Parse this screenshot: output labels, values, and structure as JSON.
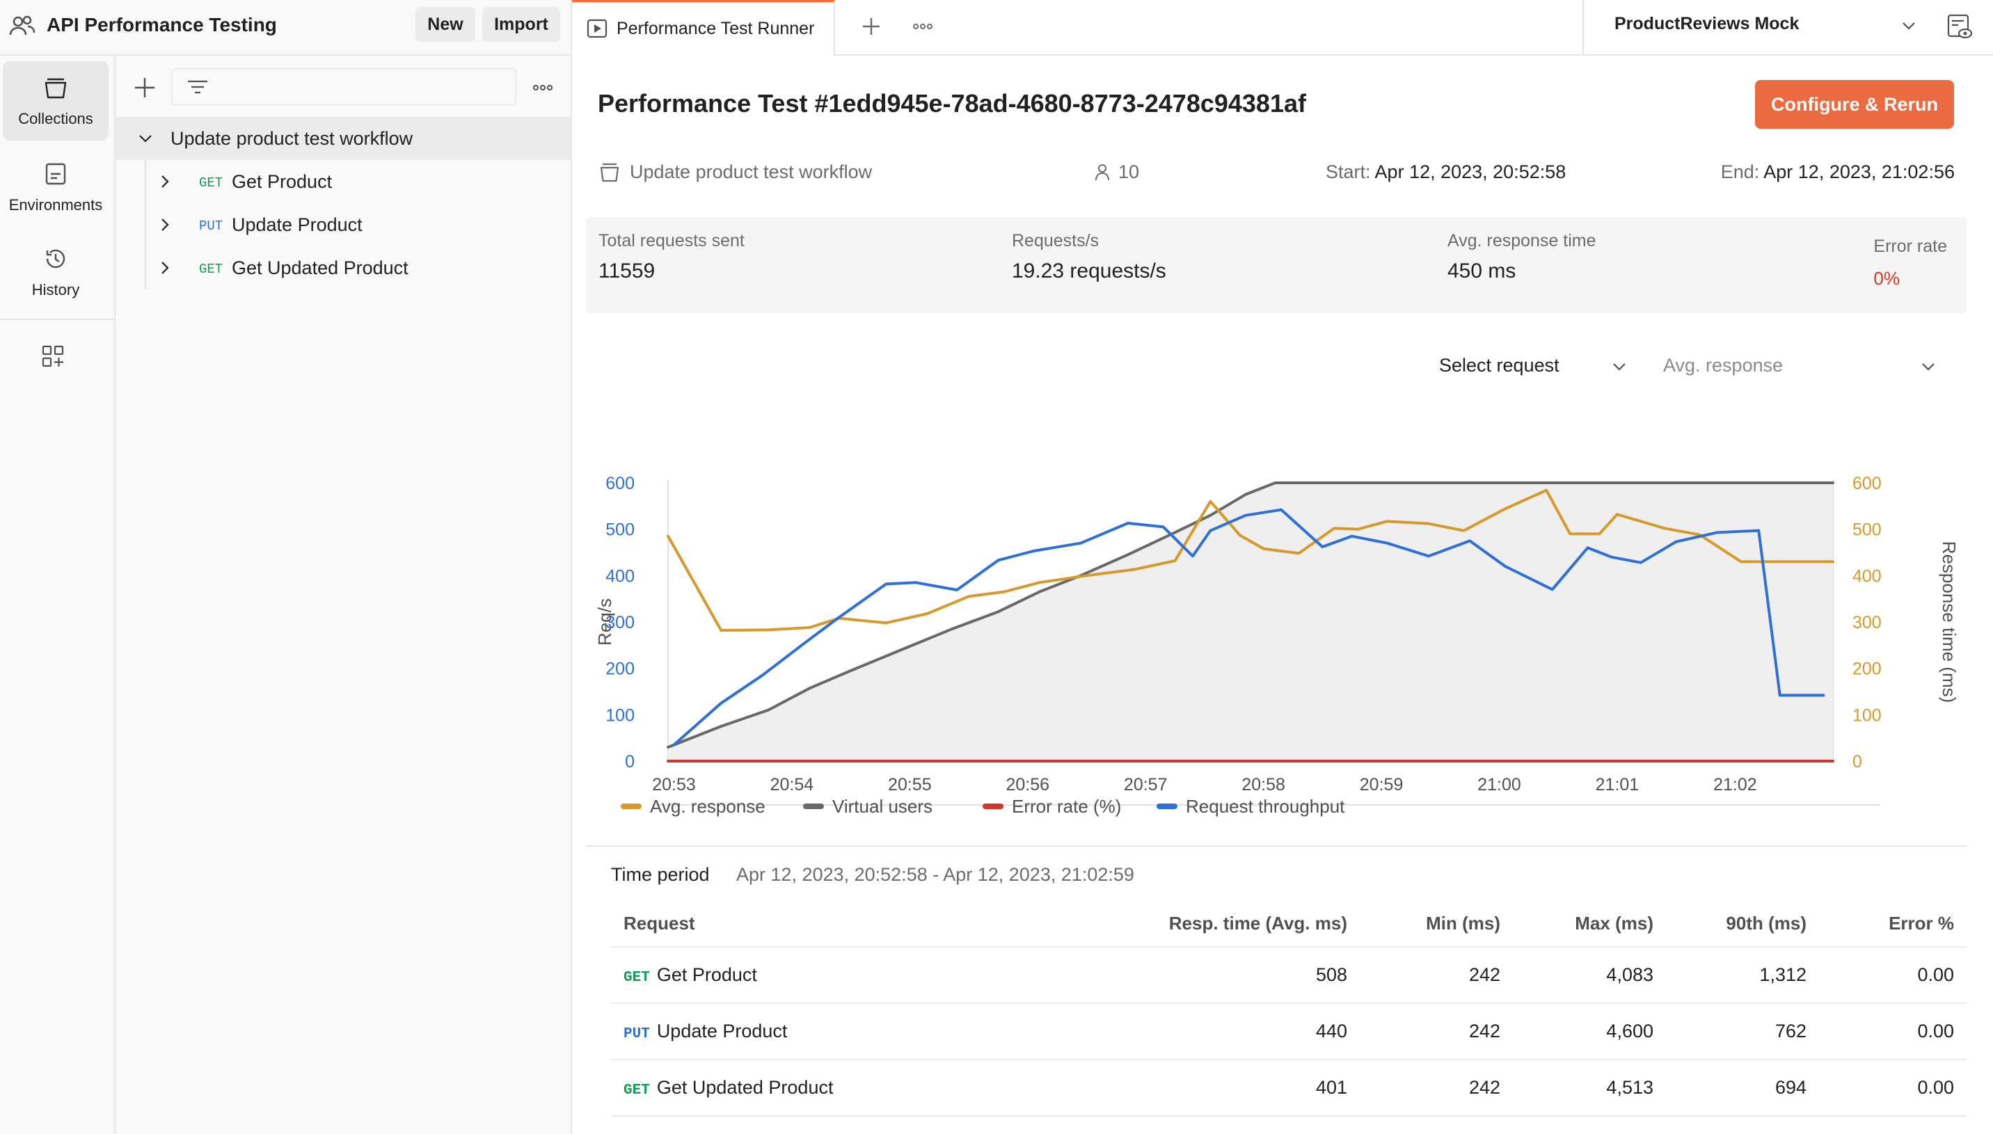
{
  "workspace": {
    "title": "API Performance Testing",
    "new_label": "New",
    "import_label": "Import"
  },
  "tabs": {
    "active_label": "Performance Test Runner"
  },
  "environment": {
    "selected": "ProductReviews Mock"
  },
  "rail": {
    "items": [
      {
        "label": "Collections"
      },
      {
        "label": "Environments"
      },
      {
        "label": "History"
      }
    ]
  },
  "sidebar": {
    "root": {
      "label": "Update product test workflow"
    },
    "items": [
      {
        "method": "GET",
        "label": "Get Product"
      },
      {
        "method": "PUT",
        "label": "Update Product"
      },
      {
        "method": "GET",
        "label": "Get Updated Product"
      }
    ]
  },
  "run": {
    "title": "Performance Test #1edd945e-78ad-4680-8773-2478c94381af",
    "rerun_label": "Configure & Rerun",
    "collection": "Update product test workflow",
    "virtual_users": "10",
    "start_label": "Start:",
    "start_value": "Apr 12, 2023, 20:52:58",
    "end_label": "End:",
    "end_value": "Apr 12, 2023, 21:02:56"
  },
  "stats": {
    "total_label": "Total requests sent",
    "total_value": "11559",
    "rps_label": "Requests/s",
    "rps_value": "19.23 requests/s",
    "avg_label": "Avg. response time",
    "avg_value": "450 ms",
    "err_label": "Error rate",
    "err_value": "0%"
  },
  "filters": {
    "request": "Select request",
    "metric": "Avg. response"
  },
  "chart_data": {
    "type": "line",
    "x_ticks": [
      "20:53",
      "20:54",
      "20:55",
      "20:56",
      "20:57",
      "20:58",
      "20:59",
      "21:00",
      "21:01",
      "21:02"
    ],
    "ylabel_left": "Req/s",
    "ylabel_right": "Response time (ms)",
    "ylim_left": [
      0,
      600
    ],
    "ylim_right": [
      0,
      600
    ],
    "y_ticks": [
      0,
      100,
      200,
      300,
      400,
      500,
      600
    ],
    "x_minutes_range": [
      -0.05,
      9.83
    ],
    "grid": false,
    "legend_position": "bottom",
    "series": [
      {
        "name": "Avg. response",
        "color": "#d59a2b",
        "axis": "right",
        "x": [
          -0.05,
          0.4,
          0.8,
          1.15,
          1.4,
          1.8,
          2.15,
          2.5,
          2.8,
          3.1,
          3.5,
          3.9,
          4.25,
          4.55,
          4.8,
          5.0,
          5.3,
          5.6,
          5.8,
          6.05,
          6.4,
          6.7,
          7.05,
          7.4,
          7.6,
          7.85,
          8.0,
          8.4,
          8.7,
          9.05,
          9.4,
          9.83
        ],
        "y": [
          485,
          282,
          283,
          288,
          308,
          298,
          318,
          355,
          365,
          385,
          400,
          413,
          432,
          560,
          487,
          458,
          448,
          502,
          500,
          517,
          512,
          497,
          544,
          584,
          490,
          490,
          532,
          502,
          488,
          430,
          430,
          430
        ]
      },
      {
        "name": "Virtual users",
        "color": "#686868",
        "axis": "left",
        "x": [
          -0.05,
          0.4,
          0.8,
          1.15,
          1.5,
          1.9,
          2.35,
          2.75,
          3.1,
          3.45,
          3.85,
          4.25,
          4.55,
          4.85,
          5.1,
          9.83
        ],
        "y": [
          30,
          75,
          110,
          157,
          195,
          237,
          284,
          322,
          365,
          400,
          445,
          493,
          530,
          575,
          600,
          600
        ]
      },
      {
        "name": "Error rate (%)",
        "color": "#d0362a",
        "axis": "left",
        "x": [
          -0.05,
          9.83
        ],
        "y": [
          0,
          0
        ]
      },
      {
        "name": "Request throughput",
        "color": "#2f6fd8",
        "axis": "left",
        "x": [
          0.0,
          0.4,
          0.75,
          1.1,
          1.4,
          1.8,
          2.05,
          2.4,
          2.75,
          3.05,
          3.45,
          3.85,
          4.15,
          4.4,
          4.55,
          4.85,
          5.15,
          5.5,
          5.75,
          6.05,
          6.4,
          6.75,
          7.05,
          7.45,
          7.75,
          7.95,
          8.2,
          8.5,
          8.85,
          9.2,
          9.38,
          9.75
        ],
        "y": [
          35,
          125,
          185,
          253,
          310,
          382,
          385,
          369,
          433,
          453,
          470,
          513,
          505,
          442,
          497,
          530,
          542,
          462,
          485,
          470,
          442,
          475,
          420,
          370,
          460,
          440,
          428,
          473,
          493,
          497,
          142,
          142
        ]
      }
    ]
  },
  "period": {
    "label": "Time period",
    "value": "Apr 12, 2023, 20:52:58 - Apr 12, 2023, 21:02:59"
  },
  "table": {
    "headers": [
      "Request",
      "Resp. time (Avg. ms)",
      "Min (ms)",
      "Max (ms)",
      "90th (ms)",
      "Error %"
    ],
    "rows": [
      {
        "method": "GET",
        "name": "Get Product",
        "avg": "508",
        "min": "242",
        "max": "4,083",
        "p90": "1,312",
        "err": "0.00"
      },
      {
        "method": "PUT",
        "name": "Update Product",
        "avg": "440",
        "min": "242",
        "max": "4,600",
        "p90": "762",
        "err": "0.00"
      },
      {
        "method": "GET",
        "name": "Get Updated Product",
        "avg": "401",
        "min": "242",
        "max": "4,513",
        "p90": "694",
        "err": "0.00"
      }
    ]
  }
}
